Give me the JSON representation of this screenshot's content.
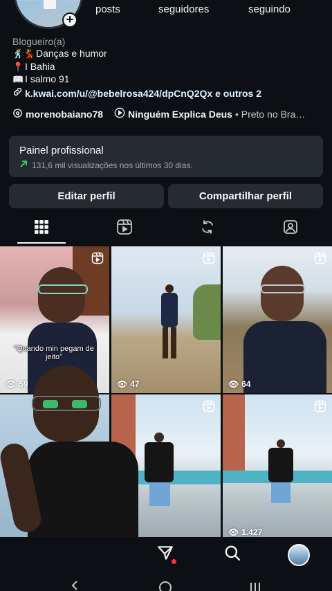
{
  "profile": {
    "stats": {
      "posts_label": "posts",
      "followers_label": "seguidores",
      "following_label": "seguindo"
    },
    "add_badge": "+",
    "category": "Blogueiro(a)",
    "bio_lines": [
      {
        "emoji": "🕺💃",
        "text": "Danças e humor"
      },
      {
        "emoji": "📍",
        "text": "I Bahia"
      },
      {
        "emoji": "📖",
        "text": "I salmo 91"
      }
    ],
    "link_text": "k.kwai.com/u/@bebelrosa424/dpCnQ2Qx e outros 2",
    "threads_handle": "morenobaiano78",
    "music_title": "Ninguém Explica Deus",
    "music_artist": "• Preto no Bra…"
  },
  "pro_panel": {
    "title": "Painel profissional",
    "subtitle": "131,6 mil visualizações nos últimos 30 dias."
  },
  "actions": {
    "edit_label": "Editar perfil",
    "share_label": "Compartilhar perfil"
  },
  "tabs": [
    "grid-icon",
    "reels-icon",
    "reposts-icon",
    "tagged-icon"
  ],
  "grid": [
    {
      "views": "59",
      "caption": "\"Quando min pegam de jeito\""
    },
    {
      "views": "47"
    },
    {
      "views": "64"
    },
    {
      "views": ""
    },
    {
      "views": ""
    },
    {
      "views": "1.427"
    }
  ],
  "colors": {
    "background": "#0c1014",
    "card": "#262b31",
    "trend_green": "#3fd17a",
    "notify_red": "#ff3040"
  }
}
